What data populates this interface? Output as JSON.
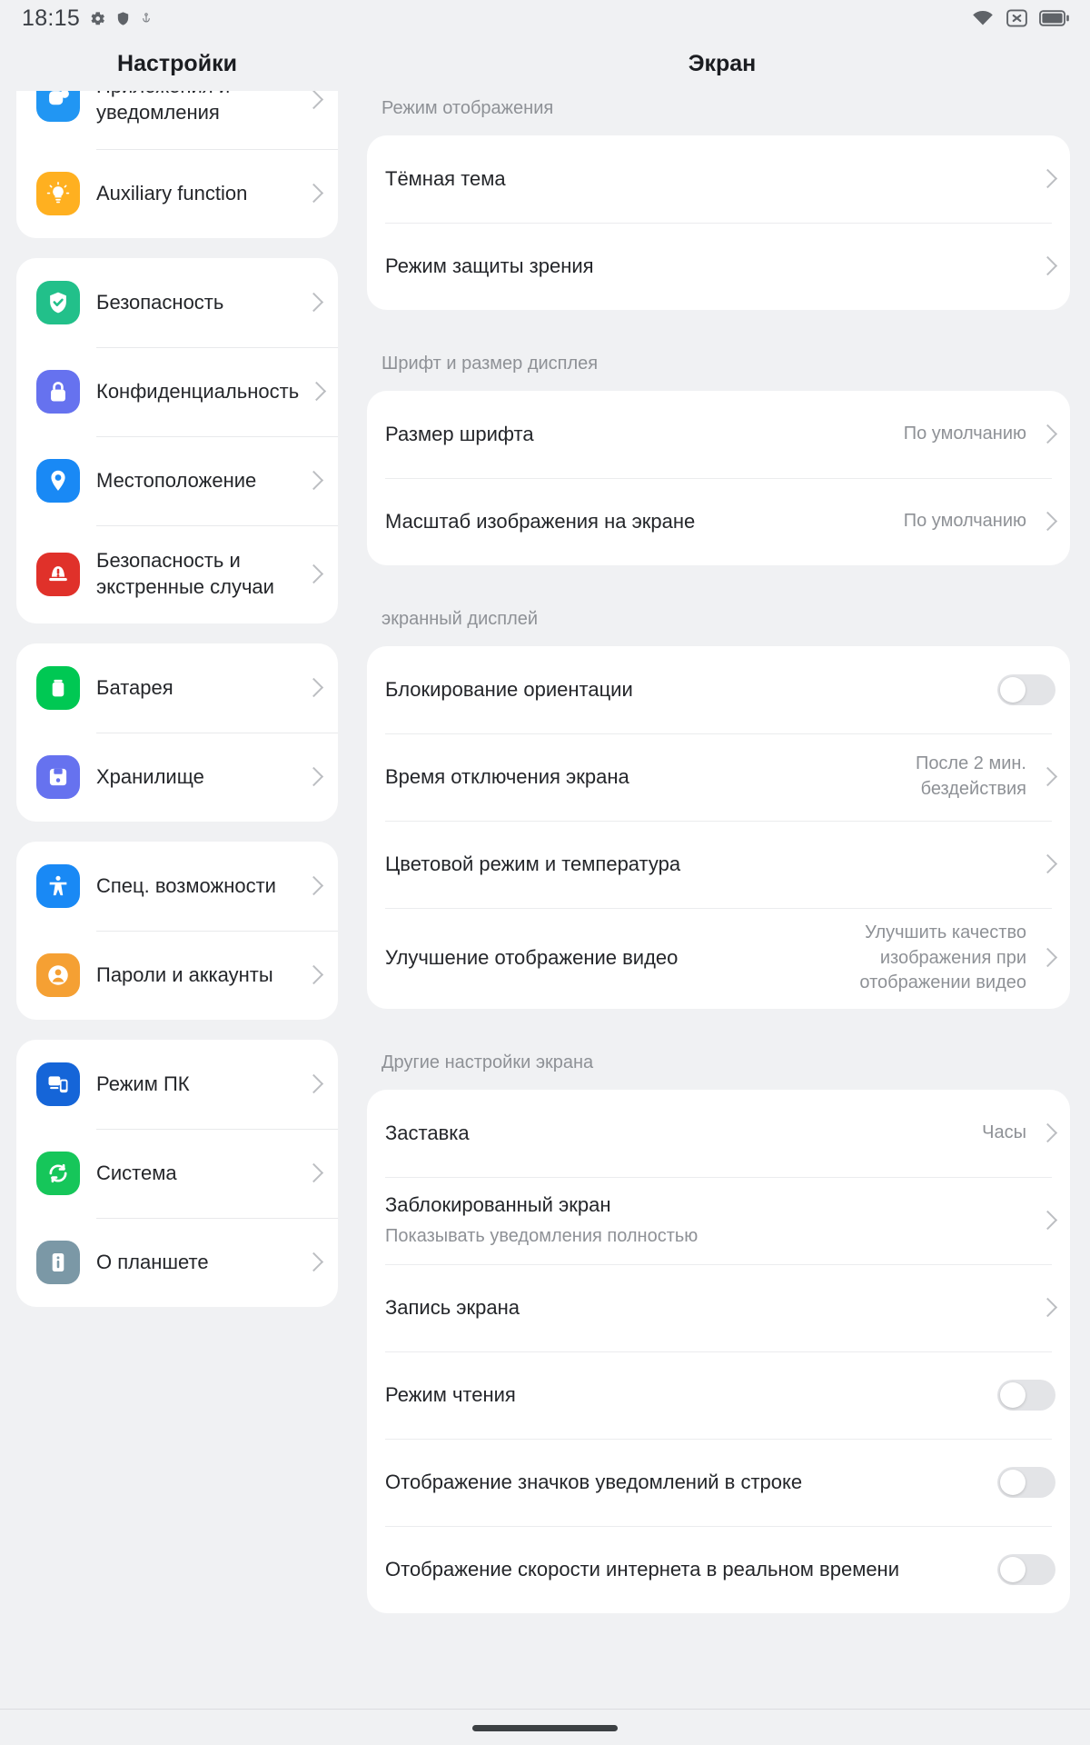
{
  "statusbar": {
    "time": "18:15",
    "left_icons": [
      "gear-icon",
      "shield-icon",
      "anchor-icon"
    ],
    "right_icons": [
      "wifi-icon",
      "no-sim-icon",
      "battery-icon"
    ]
  },
  "headers": {
    "left": "Настройки",
    "right": "Экран"
  },
  "sidebar": {
    "groups": [
      {
        "clipped": true,
        "items": [
          {
            "label": "Приложения и уведомления",
            "icon": "apps-notifications-icon",
            "color": "#2196f3"
          },
          {
            "label": "Auxiliary function",
            "icon": "lightbulb-icon",
            "color": "#ffb020"
          }
        ]
      },
      {
        "clipped": false,
        "items": [
          {
            "label": "Безопасность",
            "icon": "shield-check-icon",
            "color": "#22c08a"
          },
          {
            "label": "Конфиденциальность",
            "icon": "lock-icon",
            "color": "#6672ef"
          },
          {
            "label": "Местоположение",
            "icon": "location-pin-icon",
            "color": "#1989f5"
          },
          {
            "label": "Безопасность и экстренные случаи",
            "icon": "emergency-icon",
            "color": "#e0312a"
          }
        ]
      },
      {
        "clipped": false,
        "items": [
          {
            "label": "Батарея",
            "icon": "battery-icon",
            "color": "#00c853"
          },
          {
            "label": "Хранилище",
            "icon": "storage-floppy-icon",
            "color": "#6672ef"
          }
        ]
      },
      {
        "clipped": false,
        "items": [
          {
            "label": "Спец. возможности",
            "icon": "accessibility-icon",
            "color": "#1989f5"
          },
          {
            "label": "Пароли и аккаунты",
            "icon": "account-person-icon",
            "color": "#f5a033"
          }
        ]
      },
      {
        "clipped": false,
        "items": [
          {
            "label": "Режим ПК",
            "icon": "pc-mode-icon",
            "color": "#1565d8"
          },
          {
            "label": "Система",
            "icon": "system-sync-icon",
            "color": "#16c65a"
          },
          {
            "label": "О планшете",
            "icon": "tablet-info-icon",
            "color": "#7b98a6"
          }
        ]
      }
    ]
  },
  "display": {
    "sections": [
      {
        "title": "Режим отображения",
        "rows": [
          {
            "title": "Тёмная тема",
            "value": "",
            "sub": "",
            "control": "chevron"
          },
          {
            "title": "Режим защиты зрения",
            "value": "",
            "sub": "",
            "control": "chevron"
          }
        ]
      },
      {
        "title": "Шрифт и размер дисплея",
        "rows": [
          {
            "title": "Размер шрифта",
            "value": "По умолчанию",
            "sub": "",
            "control": "chevron"
          },
          {
            "title": "Масштаб изображения на экране",
            "value": "По умолчанию",
            "sub": "",
            "control": "chevron"
          }
        ]
      },
      {
        "title": "экранный дисплей",
        "rows": [
          {
            "title": "Блокирование ориентации",
            "value": "",
            "sub": "",
            "control": "toggle",
            "toggle_on": false
          },
          {
            "title": "Время отключения экрана",
            "value": "После 2 мин. бездействия",
            "sub": "",
            "control": "chevron"
          },
          {
            "title": "Цветовой режим и температура",
            "value": "",
            "sub": "",
            "control": "chevron"
          },
          {
            "title": "Улучшение отображение видео",
            "value": "Улучшить качество изображения при отображении видео",
            "sub": "",
            "control": "chevron"
          }
        ]
      },
      {
        "title": "Другие настройки экрана",
        "rows": [
          {
            "title": "Заставка",
            "value": "Часы",
            "sub": "",
            "control": "chevron"
          },
          {
            "title": "Заблокированный экран",
            "value": "",
            "sub": "Показывать уведомления полностью",
            "control": "chevron"
          },
          {
            "title": "Запись экрана",
            "value": "",
            "sub": "",
            "control": "chevron"
          },
          {
            "title": "Режим чтения",
            "value": "",
            "sub": "",
            "control": "toggle",
            "toggle_on": false
          },
          {
            "title": "Отображение значков уведомлений в строке",
            "value": "",
            "sub": "",
            "control": "toggle",
            "toggle_on": false
          },
          {
            "title": "Отображение скорости интернета в реальном времени",
            "value": "",
            "sub": "",
            "control": "toggle",
            "toggle_on": false
          }
        ]
      }
    ]
  }
}
